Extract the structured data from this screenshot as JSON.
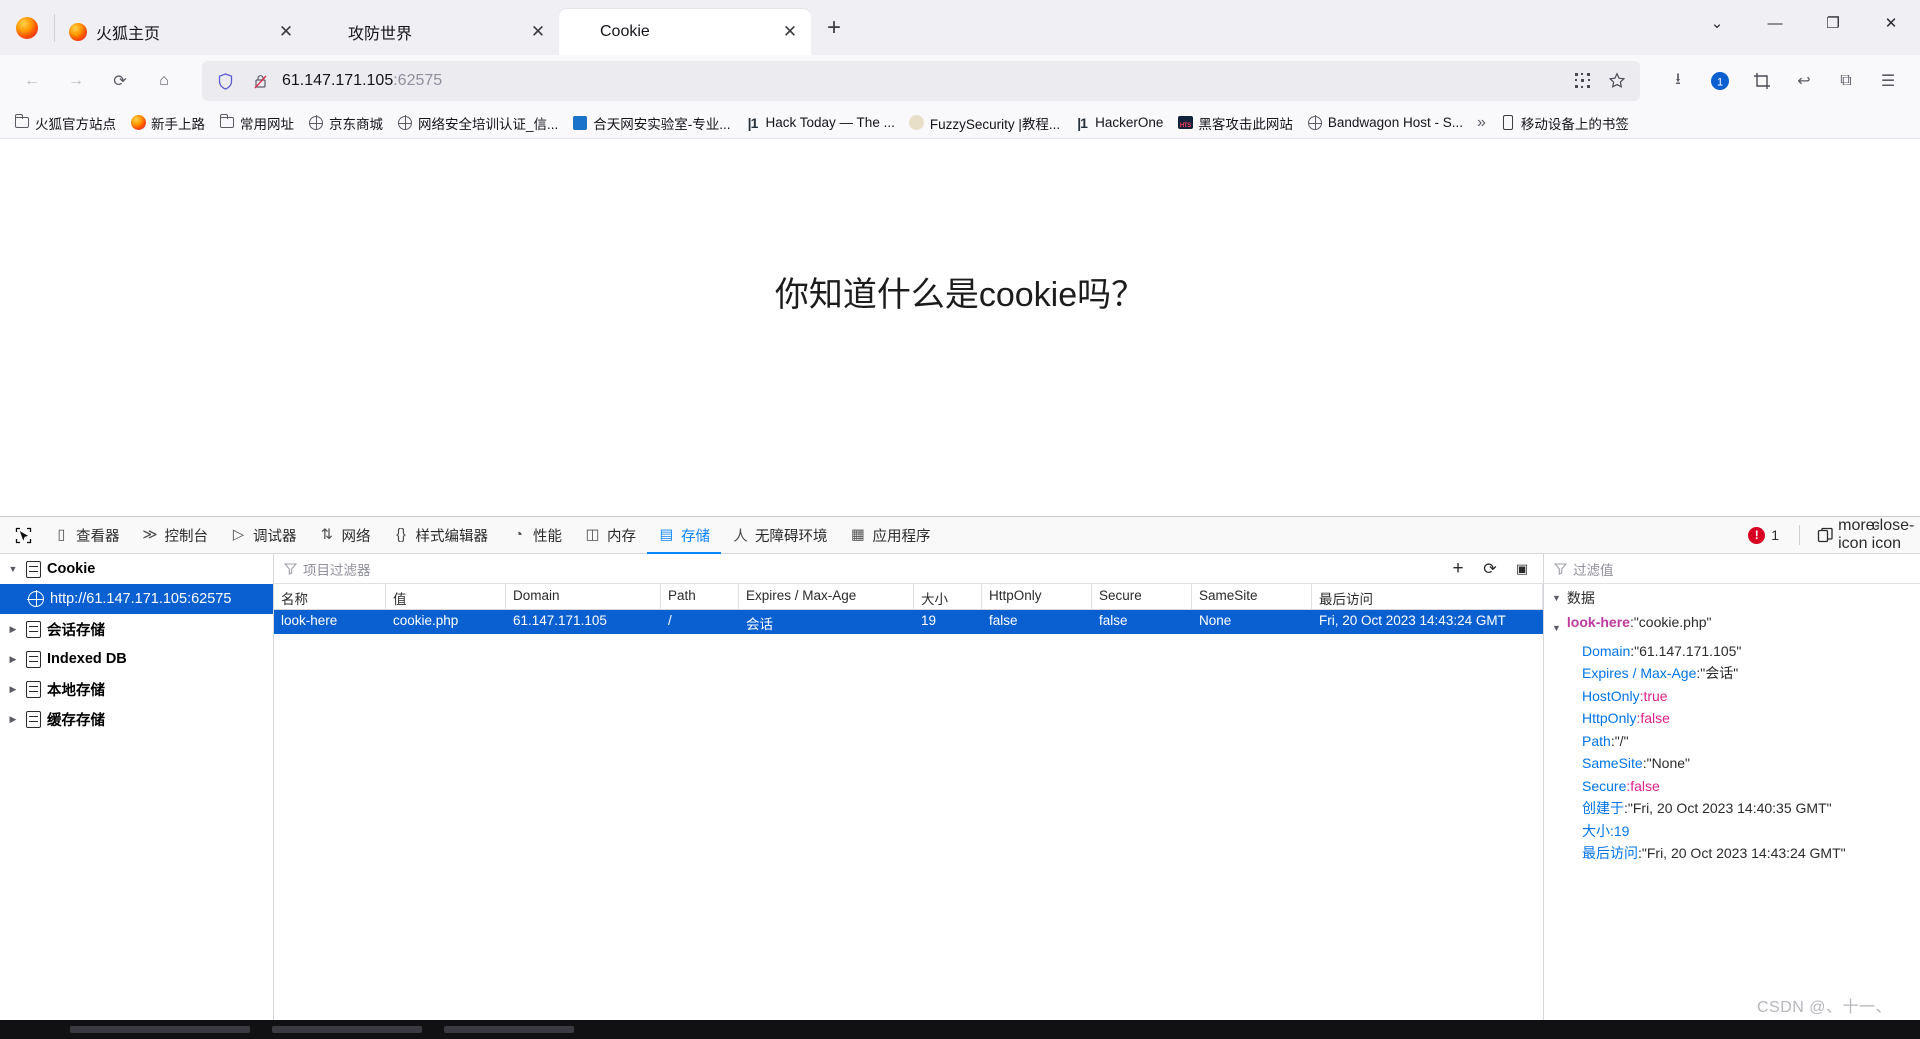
{
  "browser": {
    "tabs": [
      {
        "label": "火狐主页",
        "favicon": "firefox-icon",
        "active": false,
        "close": "✕"
      },
      {
        "label": "攻防世界",
        "favicon": "blank-icon",
        "active": false,
        "close": "✕"
      },
      {
        "label": "Cookie",
        "favicon": "blank-icon",
        "active": true,
        "close": "✕"
      }
    ],
    "new_tab": "+",
    "window_controls": {
      "list_all_tabs": "⌄",
      "minimize": "—",
      "maximize": "❐",
      "close": "✕"
    },
    "nav": {
      "back": "←",
      "forward": "→",
      "reload": "⟳",
      "home": "⌂",
      "downloads": "⭳",
      "account": "①",
      "extensions_crop": "⛶",
      "undo": "↩",
      "addons": "⧉",
      "menu": "☰"
    },
    "urlbar": {
      "shield_icon": "shield-icon",
      "lock_icon": "lock-crossed-icon",
      "host": "61.147.171.105",
      "port": ":62575",
      "qrcode_icon": "qr-icon",
      "bookmark_icon": "star-icon"
    },
    "bookmarks": [
      {
        "label": "火狐官方站点",
        "icon": "folder-icon"
      },
      {
        "label": "新手上路",
        "icon": "firefox-icon"
      },
      {
        "label": "常用网址",
        "icon": "folder-icon"
      },
      {
        "label": "京东商城",
        "icon": "globe-icon"
      },
      {
        "label": "网络安全培训认证_信...",
        "icon": "globe-icon"
      },
      {
        "label": "合天网安实验室-专业...",
        "icon": "blue-square-icon"
      },
      {
        "label": "Hack Today — The ...",
        "icon": "h1-icon"
      },
      {
        "label": "FuzzySecurity |教程...",
        "icon": "fuzzy-icon"
      },
      {
        "label": "HackerOne",
        "icon": "h1-icon"
      },
      {
        "label": "黑客攻击此网站",
        "icon": "hts-icon"
      },
      {
        "label": "Bandwagon Host - S...",
        "icon": "globe-icon"
      }
    ],
    "bookmarks_overflow": "»",
    "mobile_bookmarks": {
      "label": "移动设备上的书签",
      "icon": "phone-icon"
    }
  },
  "page": {
    "heading": "你知道什么是cookie吗？"
  },
  "devtools": {
    "picker_icon": "element-picker-icon",
    "tabs": [
      {
        "label": "查看器",
        "icon": "inspector-icon",
        "active": false
      },
      {
        "label": "控制台",
        "icon": "console-icon",
        "active": false
      },
      {
        "label": "调试器",
        "icon": "debugger-icon",
        "active": false
      },
      {
        "label": "网络",
        "icon": "network-icon",
        "active": false
      },
      {
        "label": "样式编辑器",
        "icon": "style-editor-icon",
        "active": false
      },
      {
        "label": "性能",
        "icon": "performance-icon",
        "active": false
      },
      {
        "label": "内存",
        "icon": "memory-icon",
        "active": false
      },
      {
        "label": "存储",
        "icon": "storage-icon",
        "active": true
      },
      {
        "label": "无障碍环境",
        "icon": "accessibility-icon",
        "active": false
      },
      {
        "label": "应用程序",
        "icon": "application-icon",
        "active": false
      }
    ],
    "error_count": "1",
    "error_icon": "error-icon",
    "dock_icon": "dock-icon",
    "more_icon": "more-icon",
    "close_icon": "close-icon",
    "storage_tree": [
      {
        "label": "Cookie",
        "icon": "database-icon",
        "twisty": "▼",
        "depth": 0,
        "selected": false
      },
      {
        "label": "http://61.147.171.105:62575",
        "icon": "globe-icon",
        "twisty": "",
        "depth": 1,
        "selected": true
      },
      {
        "label": "会话存储",
        "icon": "database-icon",
        "twisty": "▶",
        "depth": 0,
        "selected": false
      },
      {
        "label": "Indexed DB",
        "icon": "database-icon",
        "twisty": "▶",
        "depth": 0,
        "selected": false
      },
      {
        "label": "本地存储",
        "icon": "database-icon",
        "twisty": "▶",
        "depth": 0,
        "selected": false
      },
      {
        "label": "缓存存储",
        "icon": "database-icon",
        "twisty": "▶",
        "depth": 0,
        "selected": false
      }
    ],
    "table_filter_placeholder": "项目过滤器",
    "table_toolbar": {
      "add": "+",
      "refresh": "⟳",
      "sidebar": "▣"
    },
    "table_columns": [
      "名称",
      "值",
      "Domain",
      "Path",
      "Expires / Max-Age",
      "大小",
      "HttpOnly",
      "Secure",
      "SameSite",
      "最后访问"
    ],
    "table_rows": [
      {
        "名称": "look-here",
        "值": "cookie.php",
        "Domain": "61.147.171.105",
        "Path": "/",
        "Expires / Max-Age": "会话",
        "大小": "19",
        "HttpOnly": "false",
        "Secure": "false",
        "SameSite": "None",
        "最后访问": "Fri, 20 Oct 2023 14:43:24 GMT"
      }
    ],
    "details": {
      "filter_placeholder": "过滤值",
      "section_label": "数据",
      "root_key": "look-here",
      "root_value": "\"cookie.php\"",
      "items": [
        {
          "key": "Domain",
          "sep": ":",
          "value": "\"61.147.171.105\"",
          "kind": "string"
        },
        {
          "key": "Expires / Max-Age",
          "sep": ":",
          "value": "\"会话\"",
          "kind": "string"
        },
        {
          "key": "HostOnly",
          "sep": ":",
          "value": "true",
          "kind": "bool"
        },
        {
          "key": "HttpOnly",
          "sep": ":",
          "value": "false",
          "kind": "bool"
        },
        {
          "key": "Path",
          "sep": ":",
          "value": "\"/\"",
          "kind": "string"
        },
        {
          "key": "SameSite",
          "sep": ":",
          "value": "\"None\"",
          "kind": "string"
        },
        {
          "key": "Secure",
          "sep": ":",
          "value": "false",
          "kind": "bool"
        },
        {
          "key": "创建于",
          "sep": ":",
          "value": "\"Fri, 20 Oct 2023 14:40:35 GMT\"",
          "kind": "string"
        },
        {
          "key": "大小",
          "sep": ":",
          "value": "19",
          "kind": "num"
        },
        {
          "key": "最后访问",
          "sep": ":",
          "value": "\"Fri, 20 Oct 2023 14:43:24 GMT\"",
          "kind": "string"
        }
      ]
    }
  },
  "watermark": "CSDN @、十一、"
}
